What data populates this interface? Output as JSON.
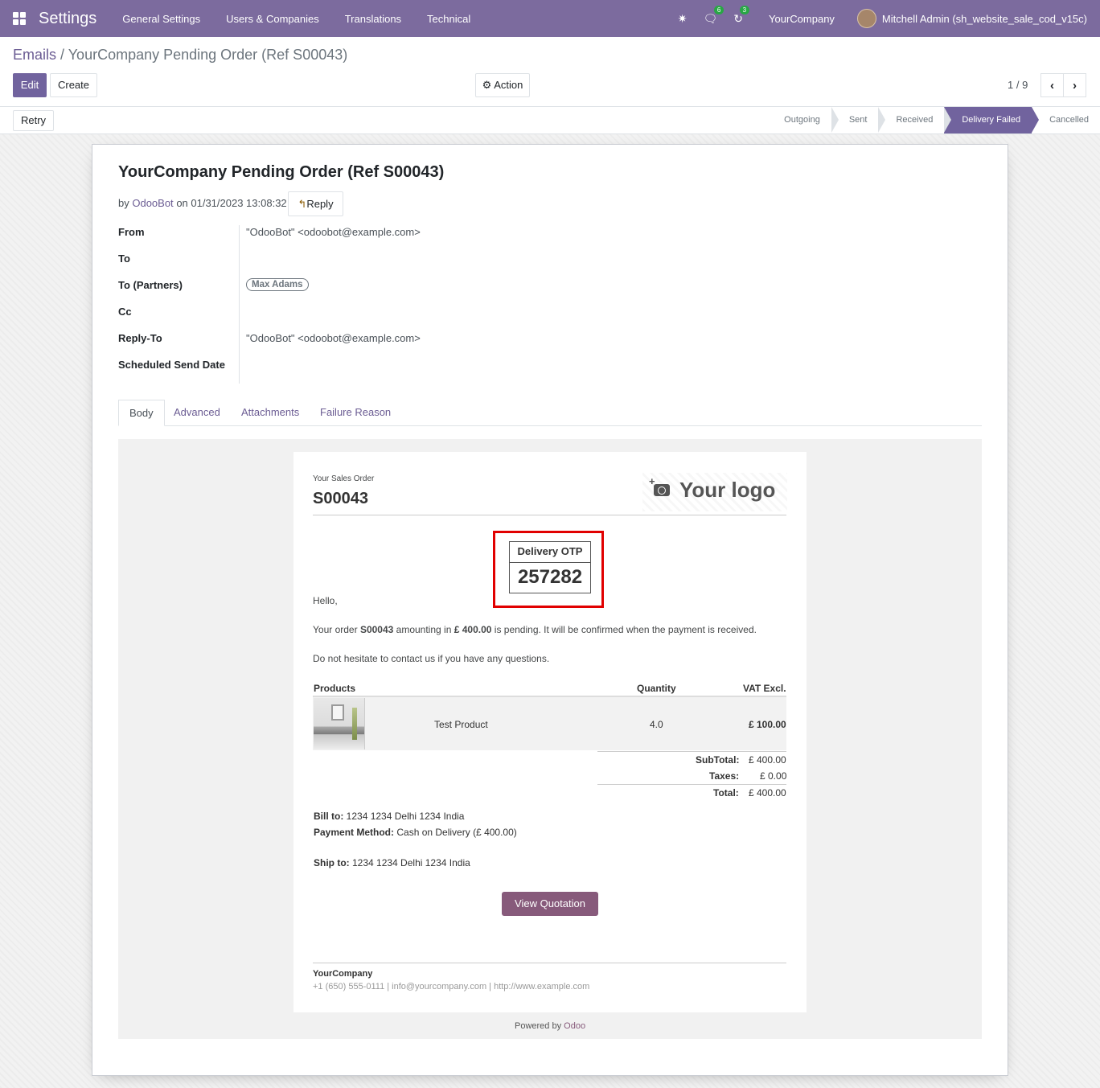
{
  "nav": {
    "brand": "Settings",
    "menus": [
      "General Settings",
      "Users & Companies",
      "Translations",
      "Technical"
    ],
    "messages_count": "6",
    "activities_count": "3",
    "company": "YourCompany",
    "user": "Mitchell Admin (sh_website_sale_cod_v15c)"
  },
  "breadcrumb": {
    "parent": "Emails",
    "current": "YourCompany Pending Order (Ref S00043)"
  },
  "toolbar": {
    "edit": "Edit",
    "create": "Create",
    "action": "Action",
    "pager": "1 / 9"
  },
  "statusbar": {
    "retry": "Retry",
    "stages": [
      "Outgoing",
      "Sent",
      "Received",
      "Delivery Failed",
      "Cancelled"
    ],
    "active_stage": "Delivery Failed"
  },
  "record": {
    "title": "YourCompany Pending Order (Ref S00043)",
    "by_prefix": "by",
    "author": "OdooBot",
    "on_text": "on 01/31/2023 13:08:32",
    "reply": "Reply",
    "fields": {
      "from_label": "From",
      "from_value": "\"OdooBot\" <odoobot@example.com>",
      "to_label": "To",
      "to_partners_label": "To (Partners)",
      "to_partners_tag": "Max Adams",
      "cc_label": "Cc",
      "reply_to_label": "Reply-To",
      "reply_to_value": "\"OdooBot\" <odoobot@example.com>",
      "scheduled_label": "Scheduled Send Date"
    },
    "tabs": [
      "Body",
      "Advanced",
      "Attachments",
      "Failure Reason"
    ],
    "active_tab": "Body"
  },
  "email": {
    "your_sales_order": "Your Sales Order",
    "order_ref": "S00043",
    "logo_text": "Your logo",
    "otp_label": "Delivery OTP",
    "otp_value": "257282",
    "greeting": "Hello,",
    "line1_a": "Your order",
    "line1_order": "S00043",
    "line1_b": "amounting in",
    "line1_amount": "£ 400.00",
    "line1_c": "is pending. It will be confirmed when the payment is received.",
    "line2": "Do not hesitate to contact us if you have any questions.",
    "table_headers": {
      "products": "Products",
      "quantity": "Quantity",
      "vat_excl": "VAT Excl."
    },
    "product": {
      "name": "Test Product",
      "qty": "4.0",
      "price": "£ 100.00"
    },
    "totals": {
      "subtotal_label": "SubTotal:",
      "subtotal": "£ 400.00",
      "taxes_label": "Taxes:",
      "taxes": "£ 0.00",
      "total_label": "Total:",
      "total": "£ 400.00"
    },
    "bill_to_label": "Bill to:",
    "bill_to": "1234 1234 Delhi 1234 India",
    "payment_label": "Payment Method:",
    "payment": "Cash on Delivery (£ 400.00)",
    "ship_to_label": "Ship to:",
    "ship_to": "1234 1234 Delhi 1234 India",
    "view_button": "View Quotation",
    "footer_company": "YourCompany",
    "footer_contact": "+1 (650) 555-0111 | info@yourcompany.com | http://www.example.com",
    "powered_by": "Powered by",
    "powered_brand": "Odoo"
  },
  "colors": {
    "navbar": "#7c6b9e",
    "primary": "#71639e",
    "odoo_brand": "#875a7b",
    "highlight_box": "#e10000"
  }
}
